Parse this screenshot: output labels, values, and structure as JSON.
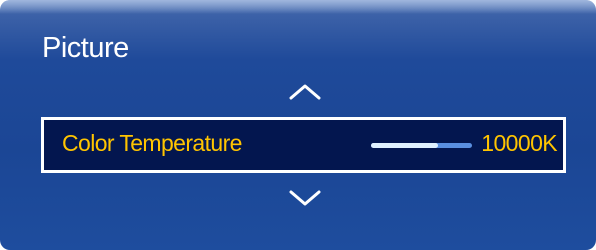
{
  "screen": {
    "title": "Picture"
  },
  "setting": {
    "label": "Color Temperature",
    "value": "10000K",
    "level": 0.66
  },
  "icons": {
    "up": "chevron-up-icon",
    "down": "chevron-down-icon"
  },
  "colors": {
    "highlight_text": "#ffc400",
    "selected_row": "#03164f",
    "panel": "#1b4695"
  }
}
